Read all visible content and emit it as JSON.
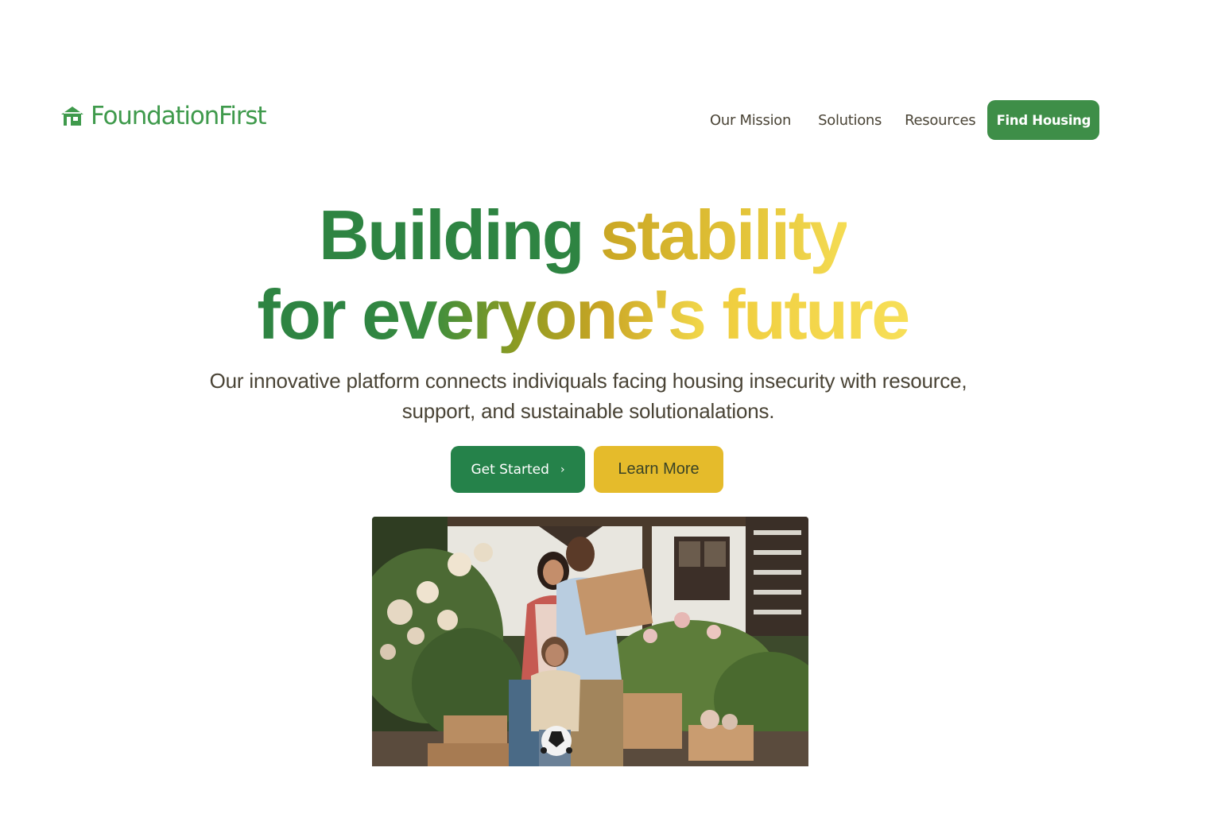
{
  "brand": {
    "name": "FoundationFirst",
    "icon": "house-icon",
    "color": "#3f9a4c"
  },
  "nav": {
    "items": [
      {
        "label": "Our Mission"
      },
      {
        "label": "Solutions"
      },
      {
        "label": "Resources"
      }
    ],
    "cta_label": "Find Housing"
  },
  "hero": {
    "title_line1": [
      "Building",
      "stability"
    ],
    "title_line2": [
      "for ",
      "everyone's",
      " future"
    ],
    "subtitle_line1": "Our innovative platform connects indiviquals facing housing insecurity with resource,",
    "subtitle_line2": "support, and sustainable solutionalations.",
    "primary_button": "Get Started",
    "primary_icon": "chevron-right-icon",
    "secondary_button": "Learn More",
    "image_alt": "family-moving-in-photo"
  },
  "colors": {
    "primary_green": "#25824a",
    "accent_yellow": "#e5bb2b",
    "text": "#4a4436"
  }
}
